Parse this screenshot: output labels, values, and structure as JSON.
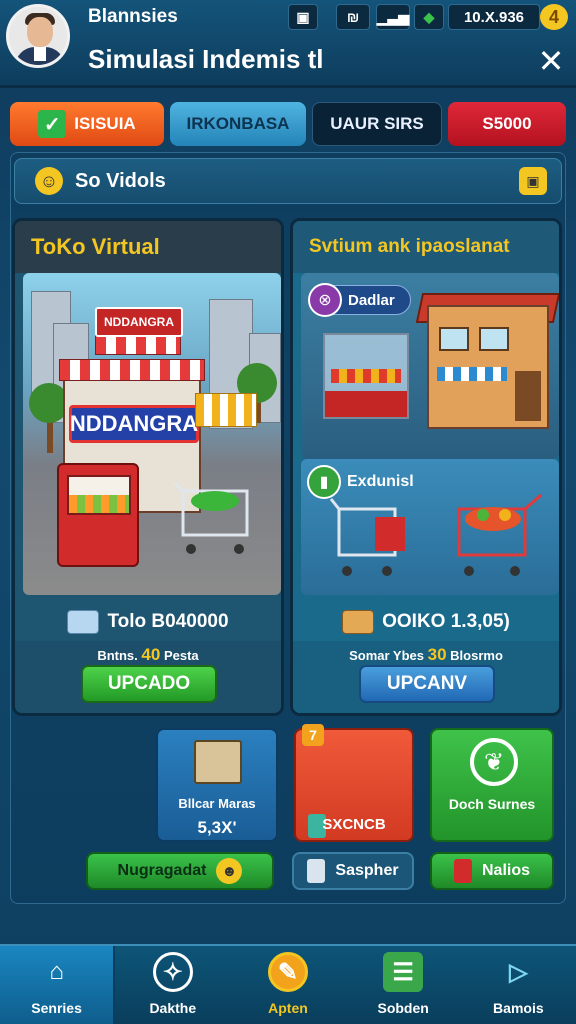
{
  "header": {
    "player_name": "Blannsies",
    "title": "Simulasi Indemis tl",
    "stats": [
      "▣",
      "₪",
      "▁▃▅",
      "◆"
    ],
    "coins": "10.X.936",
    "coin_symbol": "4",
    "close": "✕"
  },
  "tabs": [
    {
      "label": "ISISUIA",
      "color": "#e04a14"
    },
    {
      "label": "IRKONBASA",
      "color": "#2484b8"
    },
    {
      "label": "UAUR SIRS",
      "color": "#0a2236"
    },
    {
      "label": "S5000",
      "color": "#b4121f"
    }
  ],
  "notice": {
    "text": "So Vidols",
    "badge": "▣"
  },
  "left_card": {
    "title": "ToKo Virtual",
    "store_sign": "NDDANGRA",
    "mini_sign": "NDDANGRA",
    "info": "Tolo B040000",
    "sub_prefix": "Bntns.",
    "sub_number": "40",
    "sub_suffix": "Pesta",
    "button": "UPCADO"
  },
  "right_card": {
    "title": "Svtium ank ipaoslanat",
    "top_pill": "Dadlar",
    "bottom_pill": "Exdunisl",
    "info": "OOIKO 1.3,05)",
    "sub_prefix": "Somar Ybes",
    "sub_number": "30",
    "sub_suffix": "Blosrmo",
    "button": "UPCANV"
  },
  "action_buttons": [
    {
      "label": "Bllcar Maras",
      "value": "5,3X'",
      "color": "#2b80c0"
    },
    {
      "label": "SXCNCB",
      "badge": "7",
      "color": "#f05a3a"
    },
    {
      "label": "Doch Surnes",
      "color": "#3fc24a"
    }
  ],
  "mini_buttons": [
    {
      "label": "Nugragadat"
    },
    {
      "label": "Saspher"
    },
    {
      "label": "Nalios"
    }
  ],
  "nav": [
    {
      "label": "Senries",
      "icon": "home-icon",
      "active": true
    },
    {
      "label": "Dakthe",
      "icon": "compass-icon"
    },
    {
      "label": "Apten",
      "icon": "medal-icon"
    },
    {
      "label": "Sobden",
      "icon": "list-icon"
    },
    {
      "label": "Bamois",
      "icon": "play-icon"
    }
  ]
}
